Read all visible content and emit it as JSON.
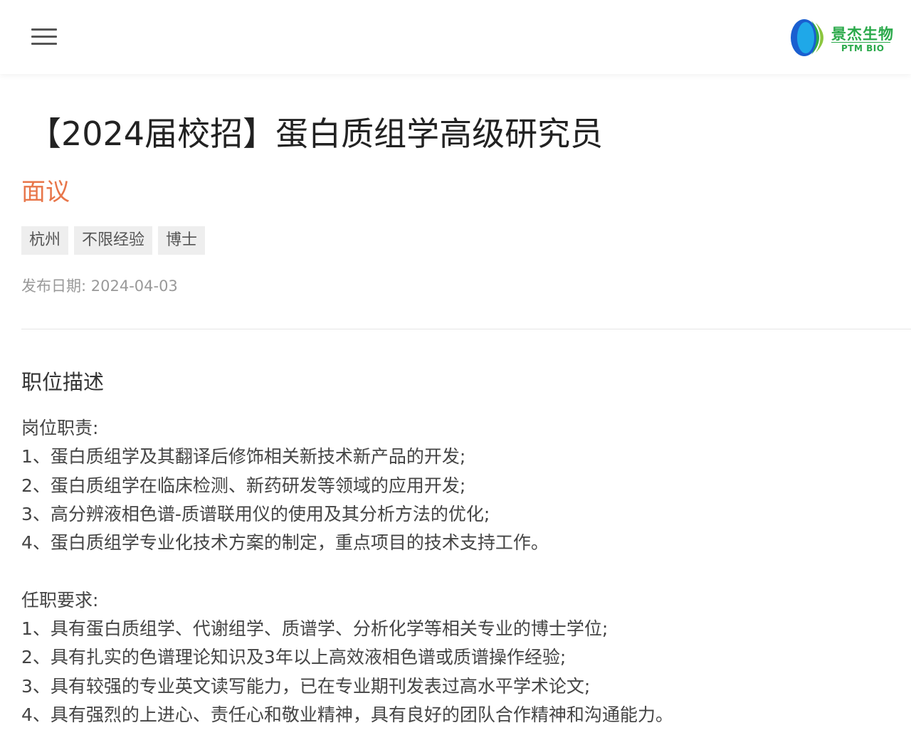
{
  "header": {
    "menu_icon": "hamburger-menu-icon",
    "logo": {
      "name_cn": "景杰生物",
      "name_en": "PTM BIO",
      "colors": [
        "#1a5fd0",
        "#2aa94a"
      ]
    }
  },
  "job": {
    "title": "【2024届校招】蛋白质组学高级研究员",
    "salary": "面议",
    "tags": [
      "杭州",
      "不限经验",
      "博士"
    ],
    "publish_date": "发布日期: 2024-04-03"
  },
  "description": {
    "section_title": "职位描述",
    "duties_heading": "岗位职责:",
    "duties": [
      "1、蛋白质组学及其翻译后修饰相关新技术新产品的开发;",
      "2、蛋白质组学在临床检测、新药研发等领域的应用开发;",
      "3、高分辨液相色谱-质谱联用仪的使用及其分析方法的优化;",
      "4、蛋白质组学专业化技术方案的制定，重点项目的技术支持工作。"
    ],
    "requirements_heading": "任职要求:",
    "requirements": [
      "1、具有蛋白质组学、代谢组学、质谱学、分析化学等相关专业的博士学位;",
      "2、具有扎实的色谱理论知识及3年以上高效液相色谱或质谱操作经验;",
      "3、具有较强的专业英文读写能力，已在专业期刊发表过高水平学术论文;",
      "4、具有强烈的上进心、责任心和敬业精神，具有良好的团队合作精神和沟通能力。"
    ]
  },
  "colors": {
    "salary": "#e8764a",
    "brand_green": "#2aa94a",
    "brand_blue": "#1a5fd0"
  }
}
